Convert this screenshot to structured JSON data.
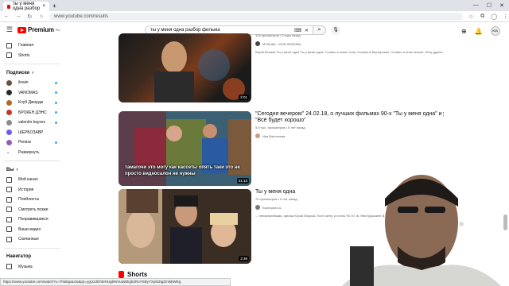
{
  "browser": {
    "tab_title": "ты у меня одна разбор",
    "tab_close": "×",
    "new_tab": "+",
    "url": "www.youtube.com/results",
    "status_url": "https://www.youtube.com/watch?v=YhiabgaL0o&pp=ygUzdGh5IHUgbWVuaWEgb2RuYSByYXpib3IgZmlsbWEg"
  },
  "header": {
    "logo_text": "Premium",
    "logo_badge": "RU",
    "search_query": "ты у меня одна разбор фильма",
    "avatar_text": "ЮА"
  },
  "sidebar": {
    "main": [
      {
        "label": "Главная",
        "icon": "home-icon"
      },
      {
        "label": "Shorts",
        "icon": "shorts-icon"
      }
    ],
    "subs_title": "Подписки",
    "subs": [
      {
        "label": "ilowin",
        "color": "#6b4f3a"
      },
      {
        "label": "VANOMAS",
        "color": "#2a2a2a"
      },
      {
        "label": "Клуб Джордж",
        "color": "#b06a2a"
      },
      {
        "label": "БРОКЕН ДЭНС",
        "color": "#c0392b"
      },
      {
        "label": "valentin kaysev",
        "color": "#8a8a8a"
      },
      {
        "label": "ШЕРБОЗАВР",
        "color": "#6c5ce7"
      },
      {
        "label": "Релизз",
        "color": "#9b59b6"
      }
    ],
    "expand_label": "Развернуть",
    "you_title": "Вы",
    "you": [
      {
        "label": "Мой канал",
        "icon": "channel-icon"
      },
      {
        "label": "История",
        "icon": "history-icon"
      },
      {
        "label": "Плейлисты",
        "icon": "playlists-icon"
      },
      {
        "label": "Смотреть позже",
        "icon": "watch-later-icon"
      },
      {
        "label": "Понравившиеся",
        "icon": "like-icon"
      },
      {
        "label": "Ваши видео",
        "icon": "your-videos-icon"
      },
      {
        "label": "Скачанные",
        "icon": "download-icon"
      }
    ],
    "nav_title": "Навигатор",
    "nav": [
      {
        "label": "Музыка",
        "icon": "music-icon"
      }
    ]
  },
  "results": [
    {
      "title": "",
      "meta": "128 просмотров • 3 года назад",
      "channel": "МУЗЫКА - МОЯ ЛЮБОВЬ",
      "snippet": "Юрий Беляев Ты у меня одна Ты у меня одна. Словно в осень тона. Словно в Бергеронах. Словно в этом сезоне. Нету других",
      "duration": "2:01"
    },
    {
      "title": "\"Сегодня вечером\" 24.02.18, о лучших фильмах 90-х \"Ты у меня одна\" и \"Всё будет хорошо\"",
      "meta": "5,5 тыс. просмотров • 5 лет назад",
      "channel": "Ира Васильева",
      "snippet": "",
      "duration": "41:13",
      "overlay": "тамагочи это могу как кассеты опять таки это не просто видеосалон не нужны"
    },
    {
      "title": "Ты у меня одна",
      "meta": "79 просмотров • 5 лет назад",
      "channel": "Екатерина А.",
      "snippet": "... гениальнейшая, фильм Юрия Мороза. Поэт актер и поэты 90-70 г.в. Янв Бурыкине В.Мо...",
      "duration": "2:38"
    }
  ],
  "shorts_label": "Shorts",
  "window": {
    "minimize": "—",
    "maximize": "☐",
    "close": "✕"
  }
}
